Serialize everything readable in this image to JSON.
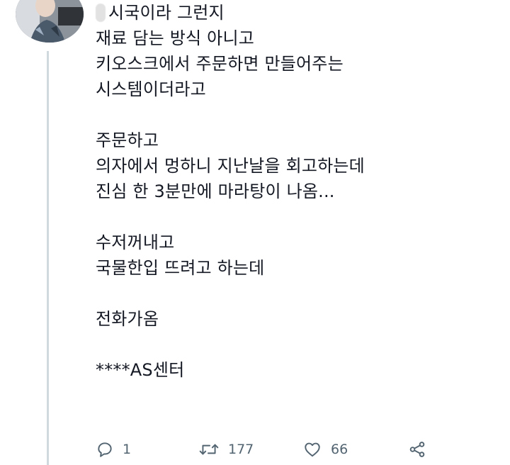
{
  "tweet": {
    "header_text": "시국이라 그런지",
    "lines": [
      "재료 담는 방식 아니고",
      "키오스크에서 주문하면 만들어주는",
      "시스템이더라고",
      "",
      "주문하고",
      "의자에서 멍하니 지난날을 회고하는데",
      "진심 한 3분만에 마라탕이 나옴...",
      "",
      "수저꺼내고",
      "국물한입 뜨려고 하는데",
      "",
      "전화가옴",
      "",
      "****AS센터"
    ]
  },
  "actions": {
    "reply_count": "1",
    "retweet_count": "177",
    "like_count": "66"
  },
  "icons": {
    "reply": "reply-icon",
    "retweet": "retweet-icon",
    "like": "heart-icon",
    "share": "share-icon"
  },
  "colors": {
    "text": "#141823",
    "action": "#536471",
    "thread_line": "#cfd9de"
  }
}
